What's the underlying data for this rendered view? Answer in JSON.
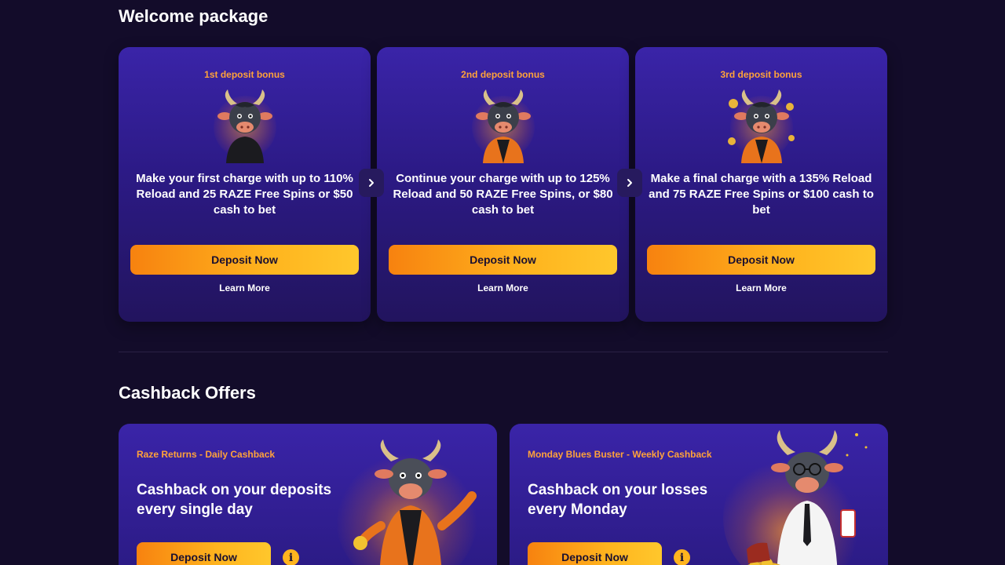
{
  "welcome": {
    "title": "Welcome package",
    "cards": [
      {
        "label": "1st deposit bonus",
        "text": "Make your first charge with up to 110% Reload and 25 RAZE Free Spins or $50 cash to bet",
        "button": "Deposit Now",
        "link": "Learn More"
      },
      {
        "label": "2nd deposit bonus",
        "text": "Continue your charge with up to 125% Reload and 50 RAZE Free Spins, or $80 cash to bet",
        "button": "Deposit Now",
        "link": "Learn More"
      },
      {
        "label": "3rd deposit bonus",
        "text": "Make a final charge with a 135% Reload and 75 RAZE Free Spins or $100 cash to bet",
        "button": "Deposit Now",
        "link": "Learn More"
      }
    ]
  },
  "cashback": {
    "title": "Cashback Offers",
    "cards": [
      {
        "label": "Raze Returns - Daily Cashback",
        "heading": "Cashback on your deposits every single day",
        "button": "Deposit Now",
        "info": "i"
      },
      {
        "label": "Monday Blues Buster - Weekly Cashback",
        "heading": "Cashback on your losses every Monday",
        "button": "Deposit Now",
        "info": "i"
      }
    ]
  },
  "icons": {
    "arrow": "chevron-right-icon",
    "info": "info-icon",
    "mascot": "bull-mascot-icon"
  },
  "colors": {
    "background": "#130c2a",
    "card": "#2f1e96",
    "accent_orange": "#ffa23a",
    "button_start": "#f7820f",
    "button_end": "#ffc72c"
  }
}
